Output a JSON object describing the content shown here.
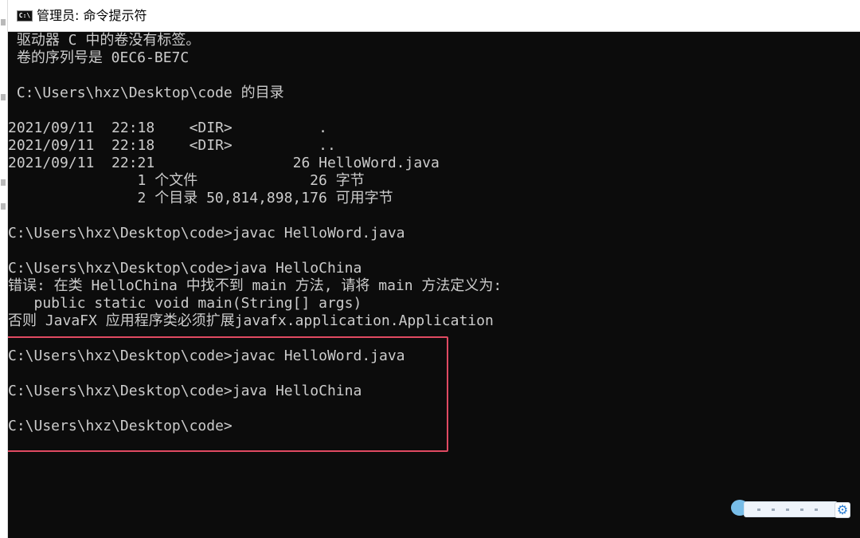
{
  "window": {
    "title": "管理员: 命令提示符",
    "icon_name": "cmd-icon",
    "icon_text": "C:\\"
  },
  "console": {
    "lines": [
      " 驱动器 C 中的卷没有标签。",
      " 卷的序列号是 0EC6-BE7C",
      "",
      " C:\\Users\\hxz\\Desktop\\code 的目录",
      "",
      "2021/09/11  22:18    <DIR>          .",
      "2021/09/11  22:18    <DIR>          ..",
      "2021/09/11  22:21                26 HelloWord.java",
      "               1 个文件             26 字节",
      "               2 个目录 50,814,898,176 可用字节",
      "",
      "C:\\Users\\hxz\\Desktop\\code>javac HelloWord.java",
      "",
      "C:\\Users\\hxz\\Desktop\\code>java HelloChina",
      "错误: 在类 HelloChina 中找不到 main 方法, 请将 main 方法定义为:",
      "   public static void main(String[] args)",
      "否则 JavaFX 应用程序类必须扩展javafx.application.Application",
      "",
      "C:\\Users\\hxz\\Desktop\\code>javac HelloWord.java",
      "",
      "C:\\Users\\hxz\\Desktop\\code>java HelloChina",
      "",
      "C:\\Users\\hxz\\Desktop\\code>"
    ]
  },
  "colors": {
    "console_background": "#0c0c0c",
    "console_text": "#cccccc",
    "highlight_border": "#e04a62",
    "titlebar_background": "#ffffff"
  },
  "overlay": {
    "icon_name": "gear-icon"
  }
}
